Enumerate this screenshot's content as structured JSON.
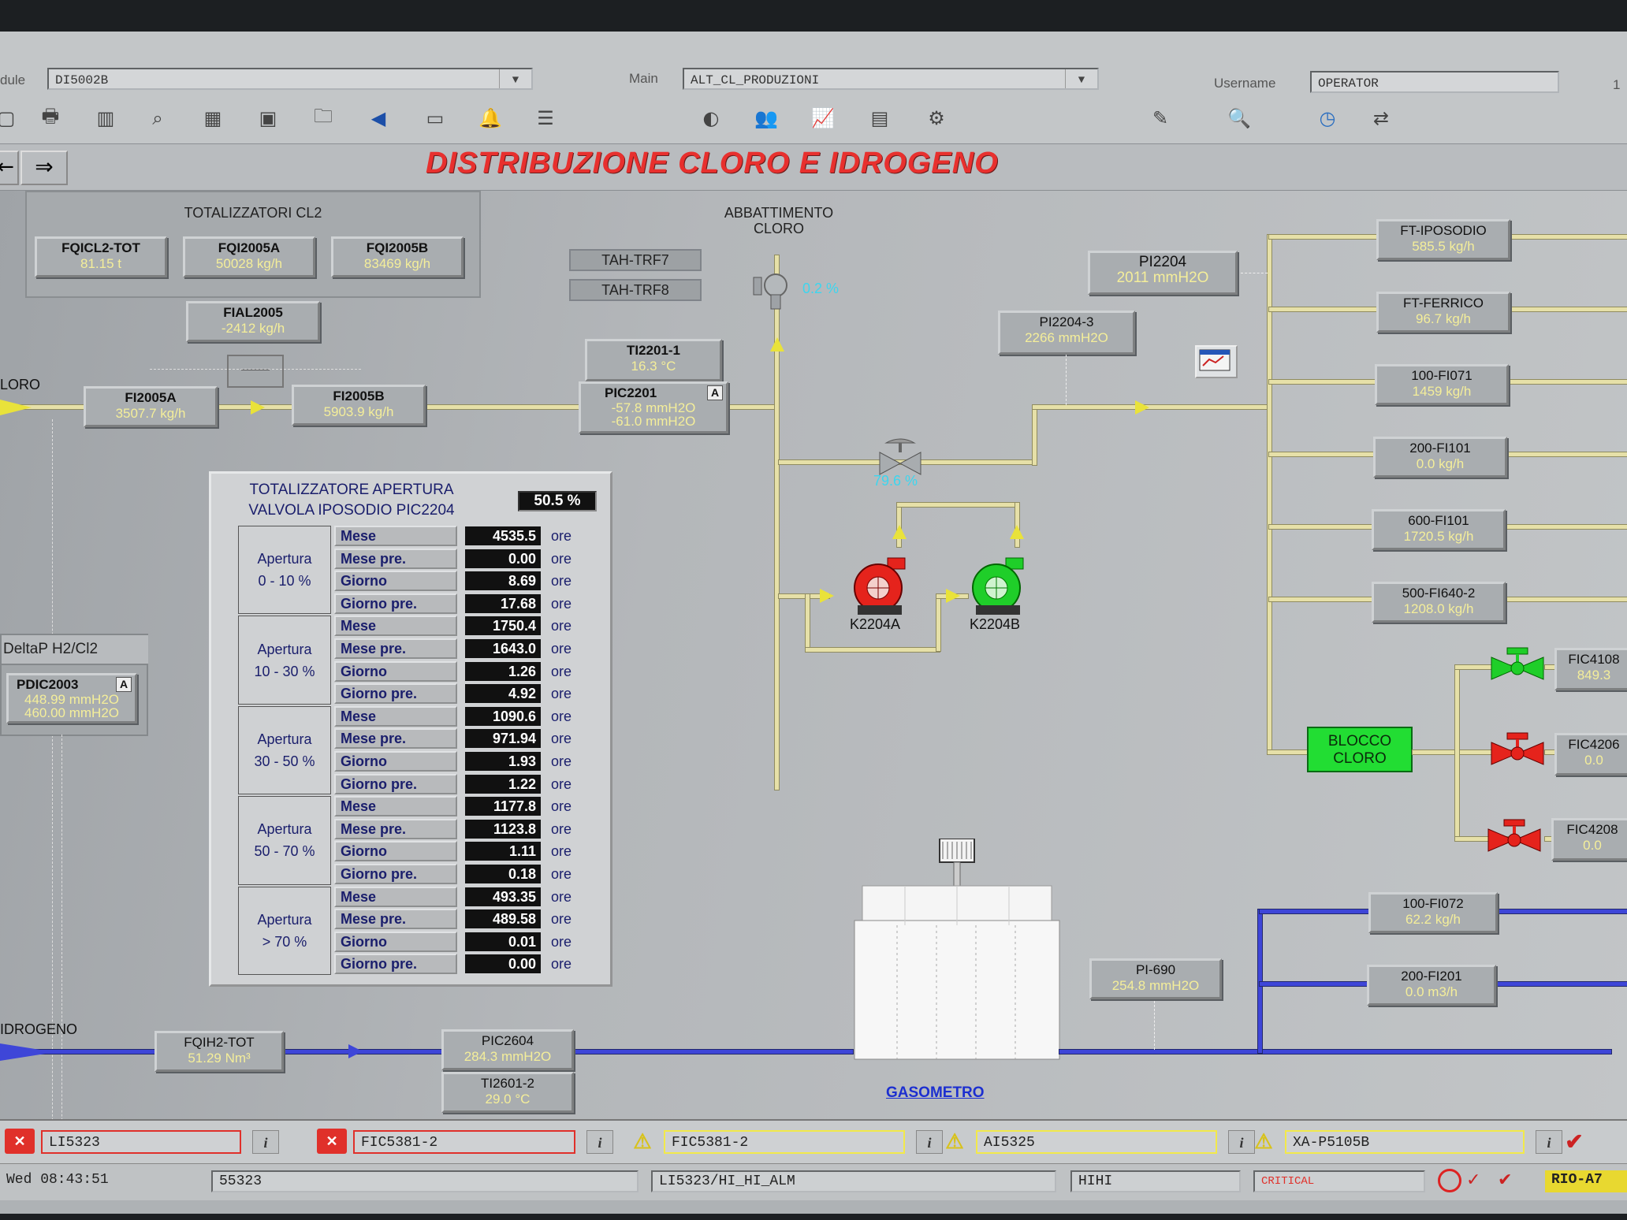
{
  "header": {
    "module_label": "dule",
    "module_value": "DI5002B",
    "main_label": "Main",
    "main_value": "ALT_CL_PRODUZIONI",
    "username_label": "Username",
    "username_value": "OPERATOR",
    "corner": "1"
  },
  "title": "DISTRIBUZIONE CLORO E IDROGENO",
  "totalizzatori_cl2": {
    "title": "TOTALIZZATORI CL2",
    "items": [
      {
        "name": "FQICL2-TOT",
        "value": "81.15 t"
      },
      {
        "name": "FQI2005A",
        "value": "50028  kg/h"
      },
      {
        "name": "FQI2005B",
        "value": "83469  kg/h"
      }
    ]
  },
  "labels": {
    "cloro_line": "LORO",
    "idrogeno_line": "IDROGENO",
    "abbattimento": "ABBATTIMENTO\nCLORO",
    "valve_top_pct": "0.2  %",
    "valve_mid_pct": "79.6  %",
    "pump_a": "K2204A",
    "pump_b": "K2204B",
    "gasometro": "GASOMETRO",
    "blocco": "BLOCCO\nCLORO",
    "deltap_title": "DeltaP H2/Cl2"
  },
  "tags": {
    "fial2005": {
      "name": "FIAL2005",
      "value": "-2412  kg/h"
    },
    "fi2005a": {
      "name": "FI2005A",
      "value": "3507.7  kg/h"
    },
    "fi2005b": {
      "name": "FI2005B",
      "value": "5903.9  kg/h"
    },
    "tah_trf7": "TAH-TRF7",
    "tah_trf8": "TAH-TRF8",
    "ti2201": {
      "name": "TI2201-1",
      "value": "16.3 °C"
    },
    "pic2201": {
      "name": "PIC2201",
      "badge": "A",
      "value1": "-57.8 mmH2O",
      "value2": "-61.0 mmH2O"
    },
    "pi2204": {
      "name": "PI2204",
      "value": "2011 mmH2O"
    },
    "pi2204_3": {
      "name": "PI2204-3",
      "value": "2266 mmH2O"
    },
    "pdic2003": {
      "name": "PDIC2003",
      "badge": "A",
      "value1": "448.99 mmH2O",
      "value2": "460.00 mmH2O"
    },
    "fqih2": {
      "name": "FQIH2-TOT",
      "value": "51.29 Nm³"
    },
    "pic2604": {
      "name": "PIC2604",
      "value": "284.3 mmH2O"
    },
    "ti2601": {
      "name": "TI2601-2",
      "value": "29.0 °C"
    },
    "pi690": {
      "name": "PI-690",
      "value": "254.8 mmH2O"
    }
  },
  "right_flows": [
    {
      "name": "FT-IPOSODIO",
      "value": "585.5 kg/h"
    },
    {
      "name": "FT-FERRICO",
      "value": "96.7 kg/h"
    },
    {
      "name": "100-FI071",
      "value": "1459  kg/h"
    },
    {
      "name": "200-FI101",
      "value": "0.0  kg/h"
    },
    {
      "name": "600-FI101",
      "value": "1720.5  kg/h"
    },
    {
      "name": "500-FI640-2",
      "value": "1208.0  kg/h"
    }
  ],
  "right_fic": [
    {
      "name": "FIC4108",
      "value": "849.3"
    },
    {
      "name": "FIC4206",
      "value": "0.0"
    },
    {
      "name": "FIC4208",
      "value": "0.0"
    }
  ],
  "h2_flows": [
    {
      "name": "100-FI072",
      "value": "62.2  kg/h"
    },
    {
      "name": "200-FI201",
      "value": "0.0  m3/h"
    }
  ],
  "totalizzatore": {
    "title1": "TOTALIZZATORE APERTURA",
    "title2": "VALVOLA IPOSODIO PIC2204",
    "pct": "50.5  %",
    "unit": "ore",
    "groups": [
      {
        "label": "Apertura\n0 - 10 %",
        "rows": [
          {
            "label": "Mese",
            "value": "4535.5"
          },
          {
            "label": "Mese pre.",
            "value": "0.00"
          },
          {
            "label": "Giorno",
            "value": "8.69"
          },
          {
            "label": "Giorno pre.",
            "value": "17.68"
          }
        ]
      },
      {
        "label": "Apertura\n10 - 30 %",
        "rows": [
          {
            "label": "Mese",
            "value": "1750.4"
          },
          {
            "label": "Mese pre.",
            "value": "1643.0"
          },
          {
            "label": "Giorno",
            "value": "1.26"
          },
          {
            "label": "Giorno pre.",
            "value": "4.92"
          }
        ]
      },
      {
        "label": "Apertura\n30 - 50 %",
        "rows": [
          {
            "label": "Mese",
            "value": "1090.6"
          },
          {
            "label": "Mese pre.",
            "value": "971.94"
          },
          {
            "label": "Giorno",
            "value": "1.93"
          },
          {
            "label": "Giorno pre.",
            "value": "1.22"
          }
        ]
      },
      {
        "label": "Apertura\n50 - 70 %",
        "rows": [
          {
            "label": "Mese",
            "value": "1177.8"
          },
          {
            "label": "Mese pre.",
            "value": "1123.8"
          },
          {
            "label": "Giorno",
            "value": "1.11"
          },
          {
            "label": "Giorno pre.",
            "value": "0.18"
          }
        ]
      },
      {
        "label": "Apertura\n> 70 %",
        "rows": [
          {
            "label": "Mese",
            "value": "493.35"
          },
          {
            "label": "Mese pre.",
            "value": "489.58"
          },
          {
            "label": "Giorno",
            "value": "0.01"
          },
          {
            "label": "Giorno pre.",
            "value": "0.00"
          }
        ]
      }
    ]
  },
  "alarms": [
    {
      "tag": "LI5323",
      "severity": "critical",
      "icon": "alarm-red-icon"
    },
    {
      "tag": "FIC5381-2",
      "severity": "critical",
      "icon": "alarm-red-icon"
    },
    {
      "tag": "FIC5381-2",
      "severity": "warning",
      "icon": "warning-triangle-icon"
    },
    {
      "tag": "AI5325",
      "severity": "warning",
      "icon": "warning-triangle-icon"
    },
    {
      "tag": "XA-P5105B",
      "severity": "warning",
      "icon": "warning-triangle-icon"
    }
  ],
  "info_glyph": "i",
  "status": {
    "datetime": "Wed 08:43:51",
    "tag": "55323",
    "message": "LI5323/HI_HI_ALM",
    "level": "HIHI",
    "severity": "CRITICAL",
    "node": "RIO-A7"
  },
  "colors": {
    "alarm_red": "#e0302a",
    "warning_yellow": "#f2e94a",
    "pipe_cl2": "#e6e0a8",
    "pipe_h2": "#3e46d8",
    "pump_red": "#e5231c",
    "pump_green": "#1fce29",
    "blocco_green": "#22dd33"
  }
}
